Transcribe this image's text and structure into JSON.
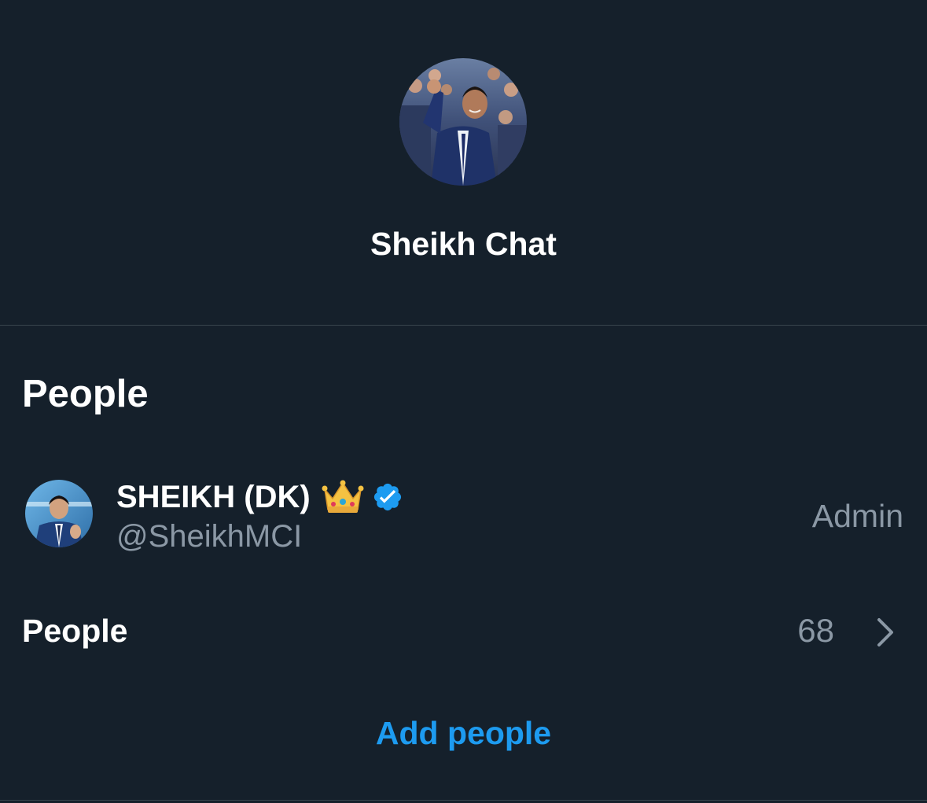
{
  "group": {
    "title": "Sheikh Chat",
    "avatar_icon": "group-photo-avatar"
  },
  "people_section": {
    "heading": "People",
    "members": [
      {
        "name": "SHEIKH (DK)",
        "badge_emoji_icon": "crown-icon",
        "verified_icon": "verified-badge-icon",
        "handle": "@SheikhMCI",
        "role": "Admin"
      }
    ],
    "count_row": {
      "label": "People",
      "count": "68",
      "chevron_icon": "chevron-right-icon"
    },
    "add_people_label": "Add people"
  },
  "colors": {
    "background": "#15202b",
    "divider": "#38444d",
    "primary_text": "#ffffff",
    "secondary_text": "#8b98a5",
    "accent": "#1d9bf0"
  }
}
